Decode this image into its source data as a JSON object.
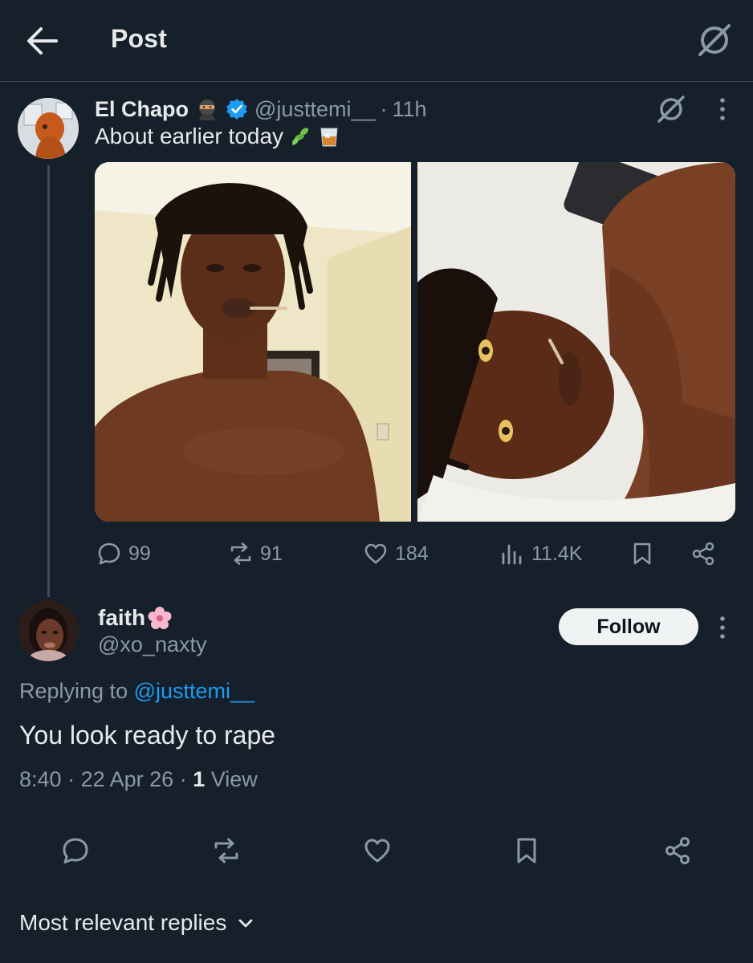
{
  "header": {
    "title": "Post",
    "back_icon": "arrow-left-icon",
    "grok_icon": "grok-icon"
  },
  "original_post": {
    "display_name": "El Chapo",
    "name_emoji": "ninja-emoji",
    "verified_icon": "verified-badge-icon",
    "handle": "@justtemi__",
    "separator": "·",
    "time": "11h",
    "text": "About earlier today",
    "text_emojis": [
      "herb-emoji",
      "tumbler-glass-emoji"
    ],
    "photos": [
      "selfie-standing",
      "selfie-lying"
    ],
    "stats": {
      "replies": "99",
      "reposts": "91",
      "likes": "184",
      "views": "11.4K"
    }
  },
  "reply": {
    "display_name": "faith",
    "name_emoji": "cherry-blossom-emoji",
    "handle": "@xo_naxty",
    "follow_label": "Follow",
    "replying_prefix": "Replying to ",
    "replying_to": "@justtemi__",
    "text": "You look ready to rape",
    "time": "8:40",
    "date": "22 Apr 26",
    "views_count": "1",
    "views_label": "View",
    "separator": "·"
  },
  "footer": {
    "sort_label": "Most relevant replies"
  },
  "colors": {
    "background": "#15202b",
    "text": "#e7e9ea",
    "secondary": "#8b98a5",
    "accent": "#1d9bf0",
    "divider": "#38444d"
  }
}
